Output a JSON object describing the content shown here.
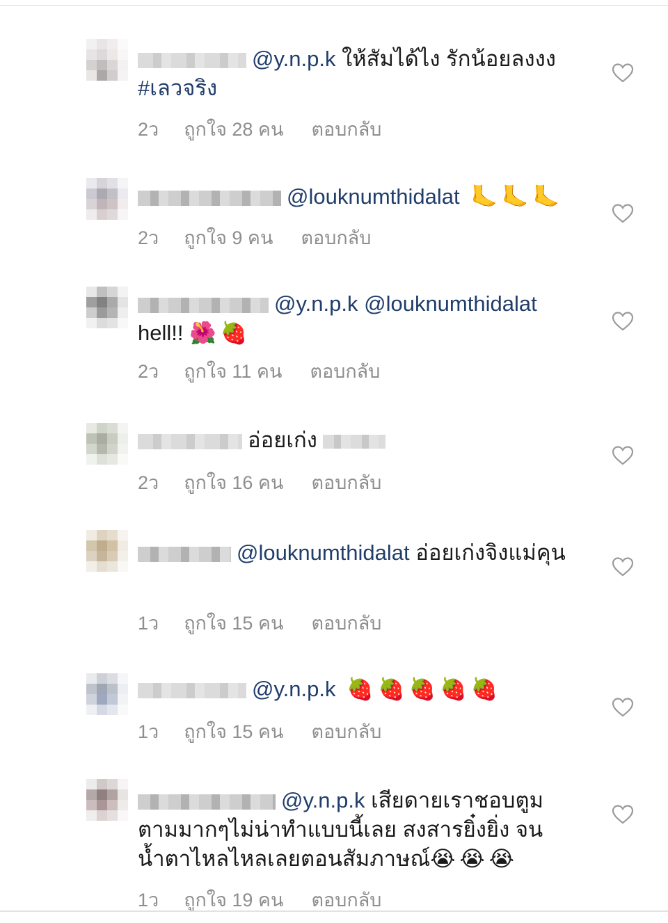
{
  "comments": [
    {
      "text_parts": [
        {
          "type": "mention",
          "text": "@y.n.p.k"
        },
        {
          "type": "text",
          "text": " ให้สัมได้ไง รักน้อยลงงง "
        },
        {
          "type": "hashtag",
          "text": "#เลวจริง"
        }
      ],
      "time": "2ว",
      "likes": "ถูกใจ 28 คน",
      "reply": "ตอบกลับ"
    },
    {
      "text_parts": [
        {
          "type": "mention",
          "text": "@louknumthidalat"
        },
        {
          "type": "emoji",
          "text": " 🦶🦶🦶"
        }
      ],
      "time": "2ว",
      "likes": "ถูกใจ 9 คน",
      "reply": "ตอบกลับ"
    },
    {
      "text_parts": [
        {
          "type": "mention",
          "text": "@y.n.p.k @louknumthidalat"
        },
        {
          "type": "text",
          "text": " hell!! "
        },
        {
          "type": "emoji",
          "text": "🌺🍓"
        }
      ],
      "time": "2ว",
      "likes": "ถูกใจ 11 คน",
      "reply": "ตอบกลับ"
    },
    {
      "text_parts": [
        {
          "type": "text",
          "text": "อ่อยเก่ง"
        }
      ],
      "time": "2ว",
      "likes": "ถูกใจ 16 คน",
      "reply": "ตอบกลับ"
    },
    {
      "text_parts": [
        {
          "type": "mention",
          "text": "@louknumthidalat"
        },
        {
          "type": "text",
          "text": " อ่อยเก่งจิงแม่คุน"
        }
      ],
      "time": "1ว",
      "likes": "ถูกใจ 15 คน",
      "reply": "ตอบกลับ"
    },
    {
      "text_parts": [
        {
          "type": "mention",
          "text": "@y.n.p.k"
        },
        {
          "type": "emoji",
          "text": " 🍓🍓🍓🍓🍓"
        }
      ],
      "time": "1ว",
      "likes": "ถูกใจ 15 คน",
      "reply": "ตอบกลับ"
    },
    {
      "text_parts": [
        {
          "type": "mention",
          "text": "@y.n.p.k"
        },
        {
          "type": "text",
          "text": " เสียดายเราชอบตูมตามมากๆไม่น่าทำแบบนี้เลย สงสารยิ๋งยิ่ง จนน้ำตาไหลไหลเลยตอนสัมภาษณ์"
        },
        {
          "type": "emoji",
          "text": "😭😭😭"
        }
      ],
      "time": "1ว",
      "likes": "ถูกใจ 19 คน",
      "reply": "ตอบกลับ"
    }
  ],
  "icons": {
    "like": "heart-outline-icon"
  },
  "colors": {
    "mention": "#203d6b",
    "meta": "#8e8e8e",
    "heart_stroke": "#9a9a9a"
  }
}
